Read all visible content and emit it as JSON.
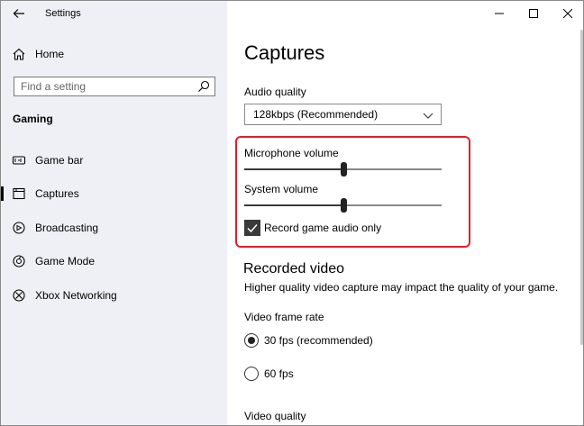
{
  "window": {
    "title": "Settings"
  },
  "sidebar": {
    "home_label": "Home",
    "search_placeholder": "Find a setting",
    "section_label": "Gaming",
    "items": [
      {
        "label": "Game bar",
        "icon": "game-bar-icon"
      },
      {
        "label": "Captures",
        "icon": "captures-icon",
        "active": true
      },
      {
        "label": "Broadcasting",
        "icon": "broadcasting-icon"
      },
      {
        "label": "Game Mode",
        "icon": "game-mode-icon"
      },
      {
        "label": "Xbox Networking",
        "icon": "xbox-icon"
      }
    ]
  },
  "main": {
    "title": "Captures",
    "audio_quality": {
      "label": "Audio quality",
      "value": "128kbps (Recommended)"
    },
    "microphone_volume": {
      "label": "Microphone volume",
      "value": 50
    },
    "system_volume": {
      "label": "System volume",
      "value": 50
    },
    "record_game_audio_only": {
      "label": "Record game audio only",
      "checked": true
    },
    "recorded_video": {
      "title": "Recorded video",
      "description": "Higher quality video capture may impact the quality of your game."
    },
    "video_frame_rate": {
      "label": "Video frame rate",
      "options": [
        {
          "label": "30 fps (recommended)",
          "selected": true
        },
        {
          "label": "60 fps",
          "selected": false
        }
      ]
    },
    "video_quality": {
      "label": "Video quality"
    }
  },
  "colors": {
    "highlight": "#e0202a",
    "sidebar_bg": "#eef0f5"
  }
}
